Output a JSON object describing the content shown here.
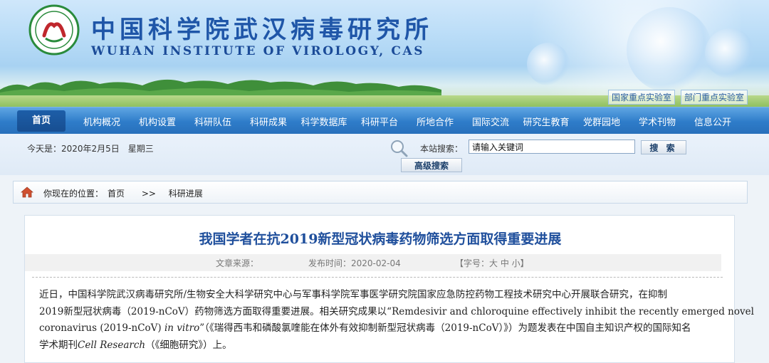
{
  "header": {
    "cn_title": "中国科学院武汉病毒研究所",
    "en_title": "WUHAN INSTITUTE OF VIROLOGY, CAS",
    "lab_links": [
      "国家重点实验室",
      "部门重点实验室"
    ]
  },
  "nav": {
    "items": [
      "首页",
      "机构概况",
      "机构设置",
      "科研队伍",
      "科研成果",
      "科学数据库",
      "科研平台",
      "所地合作",
      "国际交流",
      "研究生教育",
      "党群园地",
      "学术刊物",
      "信息公开"
    ]
  },
  "datebar": {
    "date": "今天是：2020年2月5日　星期三",
    "search_label": "本站搜索：",
    "search_value": "请输入关键词",
    "search_button": "搜 索",
    "advanced_button": "高级搜索"
  },
  "breadcrumb": {
    "prefix": "你现在的位置：",
    "home": "首页",
    "separator": ">>",
    "current": "科研进展"
  },
  "article": {
    "title": "我国学者在抗2019新型冠状病毒药物筛选方面取得重要进展",
    "source": "文章来源：",
    "publish_time": "发布时间：2020-02-04",
    "font_size": "【字号：大  中  小】",
    "lines": [
      "近日，中国科学院武汉病毒研究所/生物安全大科学研究中心与军事科学院军事医学研究院国家应急防控药物工程技术研究中心开展联合研究，在抑制",
      "2019新型冠状病毒（2019-nCoV）药物筛选方面取得重要进展。相关研究成果以“Remdesivir and chloroquine effectively inhibit the recently emerged novel",
      "coronavirus (2019-nCoV) ",
      "in vitro",
      "”（《瑞得西韦和磷酸氯喹能在体外有效抑制新型冠状病毒（2019-nCoV）》）为题发表在中国自主知识产权的国际知名",
      "学术期刊",
      "Cell Research",
      "（《细胞研究》）上。"
    ]
  },
  "colors": {
    "nav_blue": "#2e7cc9",
    "title_blue": "#1f4f9c",
    "logo_green": "#2a8b3c",
    "logo_red": "#c0272d"
  }
}
